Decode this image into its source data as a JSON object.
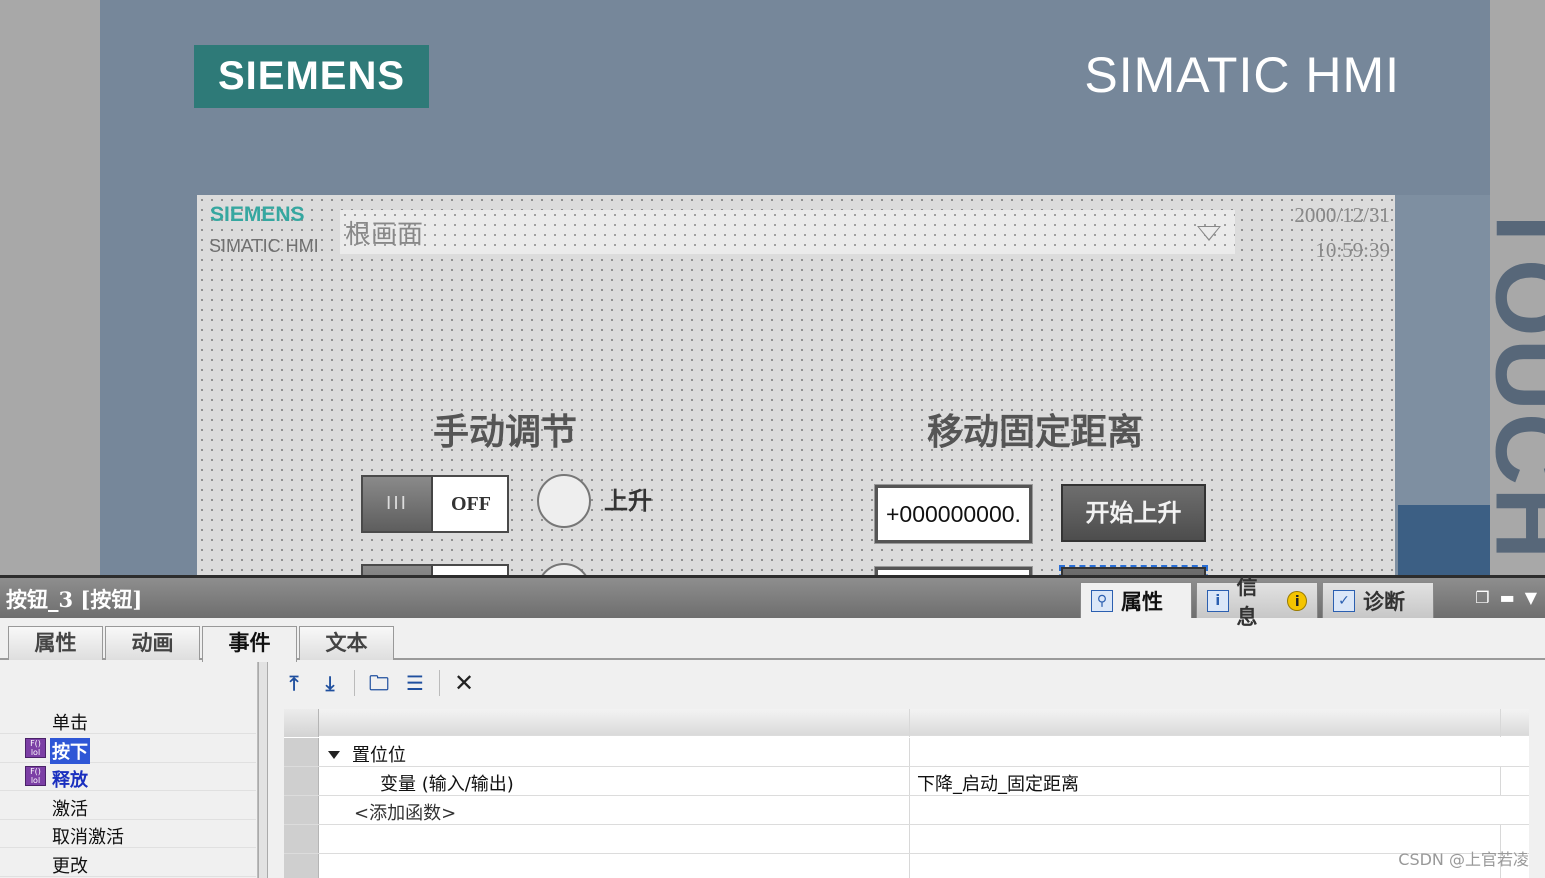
{
  "device": {
    "brand_logo": "SIEMENS",
    "title": "SIMATIC HMI",
    "side_label": "TOUCH"
  },
  "screen": {
    "logo": "SIEMENS",
    "sublogo": "SIMATIC HMI",
    "screen_select": "根画面",
    "date": "2000/12/31",
    "time": "10:59:39",
    "heading_manual": "手动调节",
    "heading_move": "移动固定距离",
    "switch_1_state": "OFF",
    "switch_knob": "III",
    "lamp_1_label": "上升",
    "io_field_1": "+000000000.",
    "btn_up_label": "开始上升"
  },
  "inspector": {
    "title": "按钮_3 [按钮]",
    "panel_tabs": [
      {
        "label": "属性",
        "icon": "properties-icon"
      },
      {
        "label": "信息",
        "icon": "info-icon"
      },
      {
        "label": "诊断",
        "icon": "diagnostics-icon"
      }
    ],
    "sub_tabs": [
      "属性",
      "动画",
      "事件",
      "文本"
    ],
    "events": [
      {
        "label": "单击",
        "has_function": false
      },
      {
        "label": "按下",
        "has_function": true,
        "selected": true
      },
      {
        "label": "释放",
        "has_function": true,
        "selected": false
      },
      {
        "label": "激活",
        "has_function": false
      },
      {
        "label": "取消激活",
        "has_function": false
      },
      {
        "label": "更改",
        "has_function": false
      }
    ],
    "toolbar": [
      "move-up-icon",
      "move-down-icon",
      "folder-icon",
      "list-icon",
      "delete-icon"
    ],
    "function_list": {
      "function_name": "置位位",
      "param_name": "变量 (输入/输出)",
      "param_value": "下降_启动_固定距离",
      "add_function": "<添加函数>"
    }
  },
  "watermark": "CSDN @上官若凌",
  "colors": {
    "device_frame": "#76879a",
    "logo_bg": "#2e7a78",
    "selection": "#2f57d6"
  }
}
